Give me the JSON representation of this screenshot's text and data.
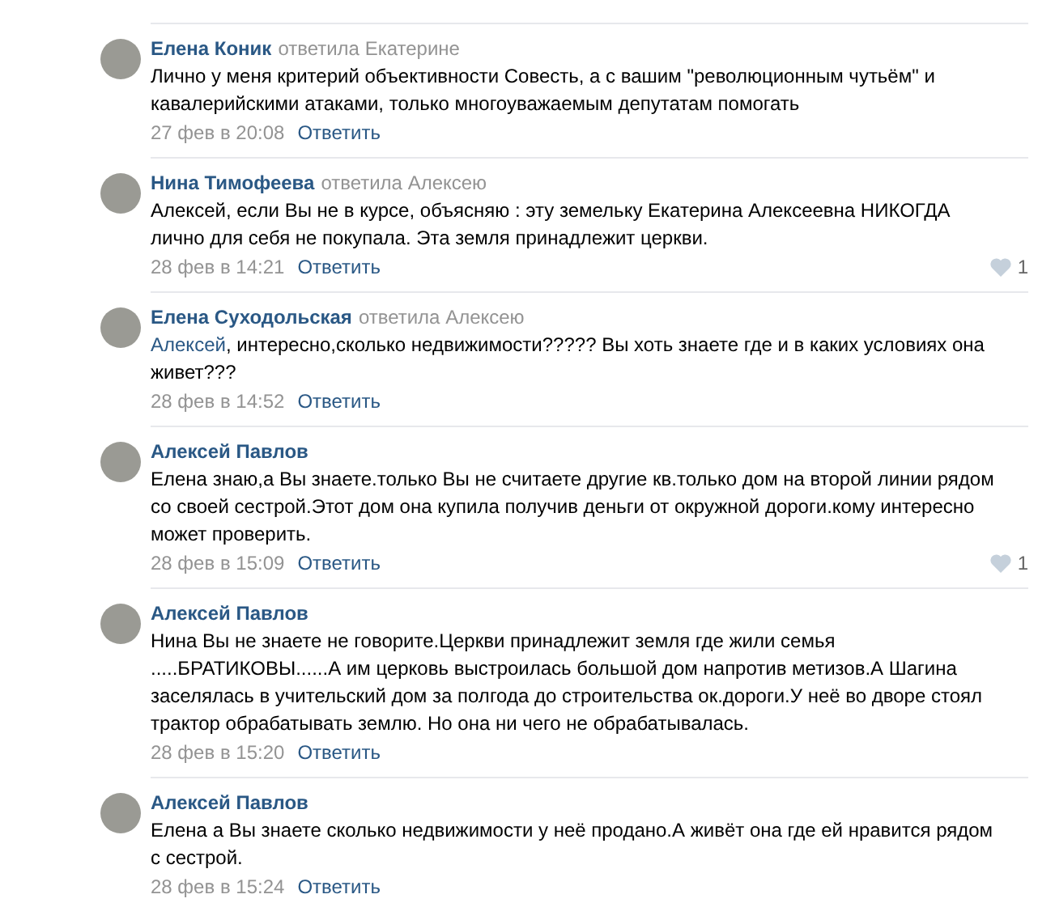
{
  "comments": [
    {
      "author": "Елена Коник",
      "reply_to": "ответила Екатерине",
      "text": "Лично у меня критерий объективности Совесть, а с вашим \"революционным чутьём\" и кавалерийскими атаками, только многоуважаемым депутатам помогать",
      "date": "27 фев в 20:08",
      "reply": "Ответить"
    },
    {
      "author": "Нина Тимофеева",
      "reply_to": "ответила Алексею",
      "text": "Алексей, если Вы не в курсе, объясняю : эту земельку Екатерина Алексеевна НИКОГДА лично для себя не покупала. Эта земля принадлежит церкви.",
      "date": "28 фев в 14:21",
      "reply": "Ответить",
      "likes": "1"
    },
    {
      "author": "Елена Суходольская",
      "reply_to": "ответила Алексею",
      "mention": "Алексей",
      "text": ", интересно,сколько недвижимости????? Вы хоть знаете где и в каких условиях она живет???",
      "date": "28 фев в 14:52",
      "reply": "Ответить"
    },
    {
      "author": "Алексей Павлов",
      "text": "Елена знаю,а Вы знаете.только Вы не считаете другие кв.только дом на второй линии рядом со своей сестрой.Этот дом она купила получив деньги от окружной дороги.кому интересно может проверить.",
      "date": "28 фев в 15:09",
      "reply": "Ответить",
      "likes": "1"
    },
    {
      "author": "Алексей Павлов",
      "text": "Нина Вы не знаете не говорите.Церкви принадлежит земля где жили семья .....БРАТИКОВЫ......А им церковь выстроилась большой дом напротив метизов.А Шагина заселялась в учительский дом за полгода до строительства ок.дороги.У неё во дворе стоял трактор обрабатывать землю. Но она ни чего не обрабатывалась.",
      "date": "28 фев в 15:20",
      "reply": "Ответить"
    },
    {
      "author": "Алексей Павлов",
      "text": "Елена а Вы знаете сколько недвижимости у неё продано.А живёт она где ей нравится рядом с сестрой.",
      "date": "28 фев в 15:24",
      "reply": "Ответить"
    }
  ]
}
